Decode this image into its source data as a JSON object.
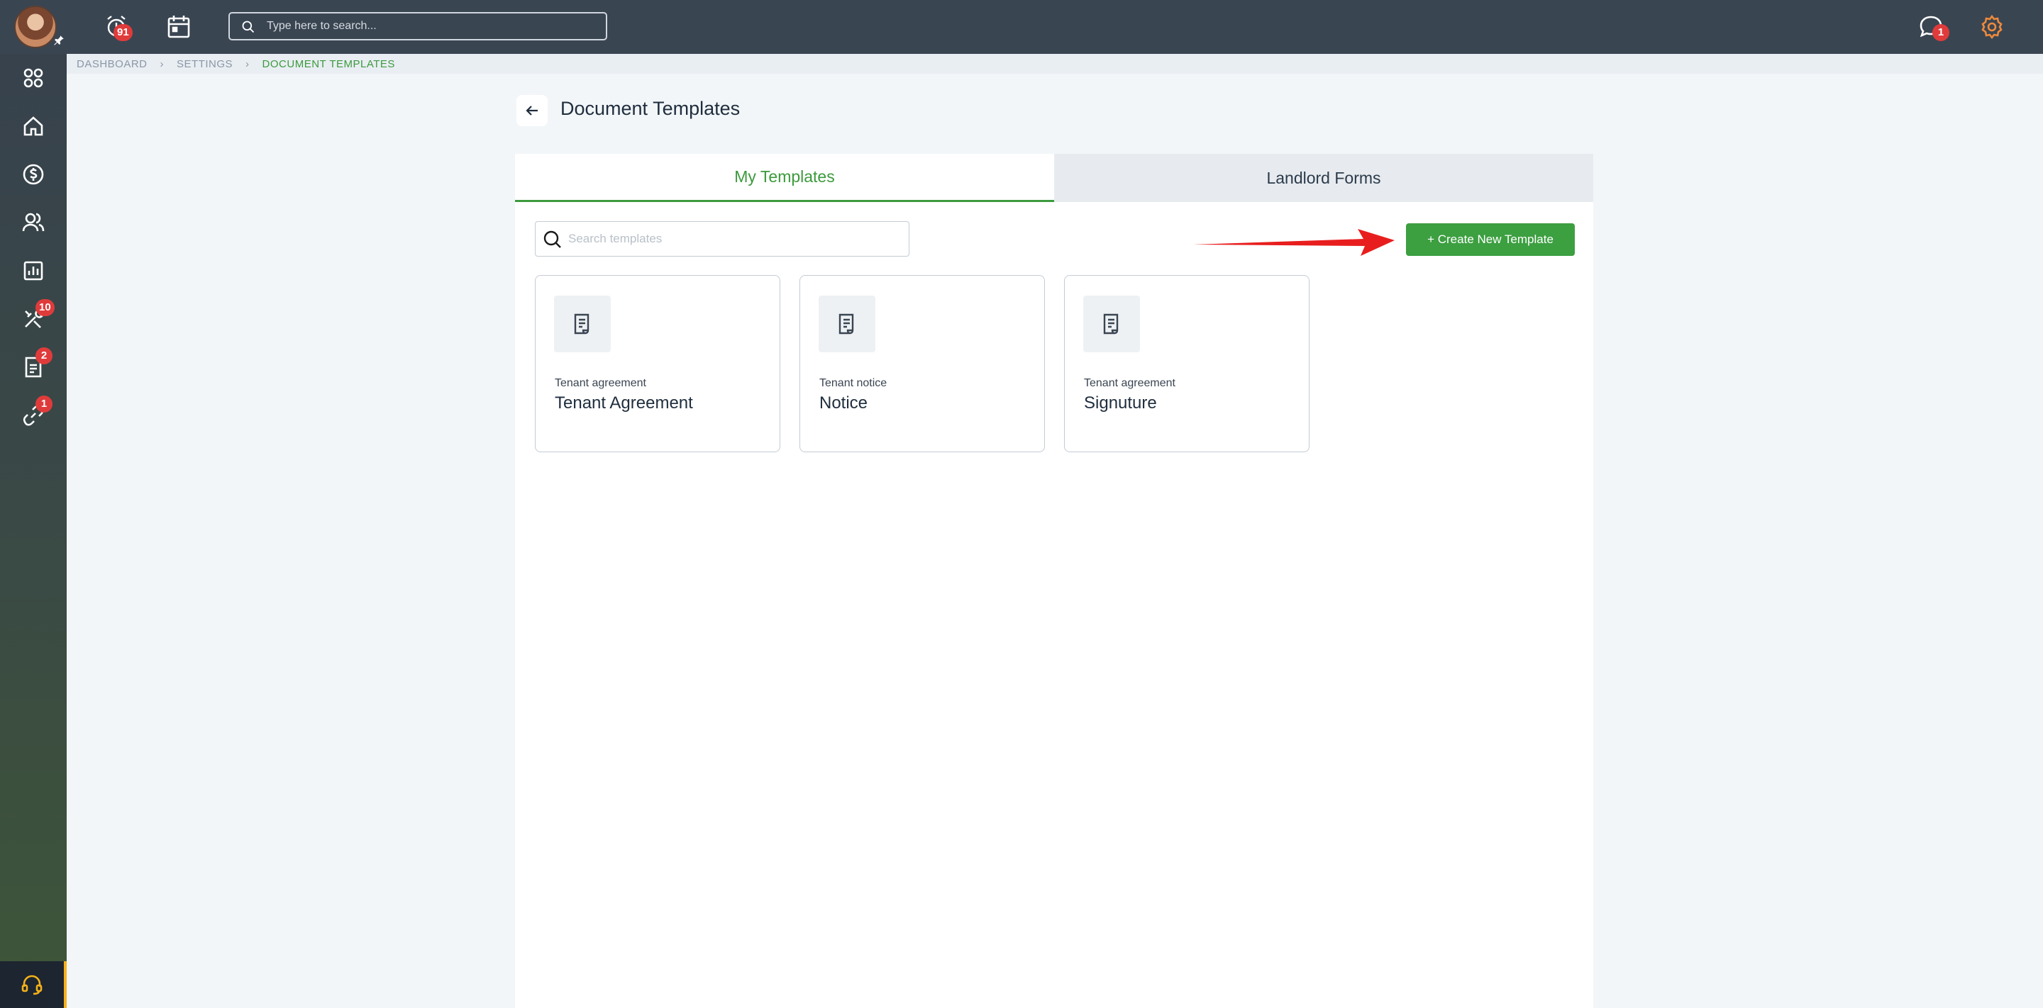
{
  "topbar": {
    "search_placeholder": "Type here to search...",
    "alarm_badge": "91",
    "chat_badge": "1"
  },
  "sidebar": {
    "badges": {
      "maintenance": "10",
      "documents": "2",
      "links": "1"
    }
  },
  "breadcrumb": [
    "DASHBOARD",
    "SETTINGS",
    "DOCUMENT TEMPLATES"
  ],
  "page": {
    "title": "Document Templates"
  },
  "tabs": [
    {
      "label": "My Templates",
      "active": true
    },
    {
      "label": "Landlord Forms",
      "active": false
    }
  ],
  "templates_search": {
    "placeholder": "Search templates"
  },
  "create_button": {
    "label": "+ Create New Template"
  },
  "templates": [
    {
      "type": "Tenant agreement",
      "name": "Tenant Agreement"
    },
    {
      "type": "Tenant notice",
      "name": "Notice"
    },
    {
      "type": "Tenant agreement",
      "name": "Signuture"
    }
  ],
  "colors": {
    "accent": "#3c9f40",
    "topbar": "#3a4552",
    "badge": "#e03b3b",
    "gear": "#f08a3a",
    "annotation_arrow": "#e81e1e"
  },
  "icons": {
    "topbar": [
      "alarm-clock-icon",
      "calendar-icon",
      "search-icon",
      "chat-icon",
      "gear-icon"
    ],
    "sidebar": [
      "apps-grid-icon",
      "home-icon",
      "dollar-icon",
      "users-icon",
      "chart-icon",
      "tools-icon",
      "document-icon",
      "link-icon",
      "headset-icon"
    ],
    "template_card": "document-template-icon"
  }
}
